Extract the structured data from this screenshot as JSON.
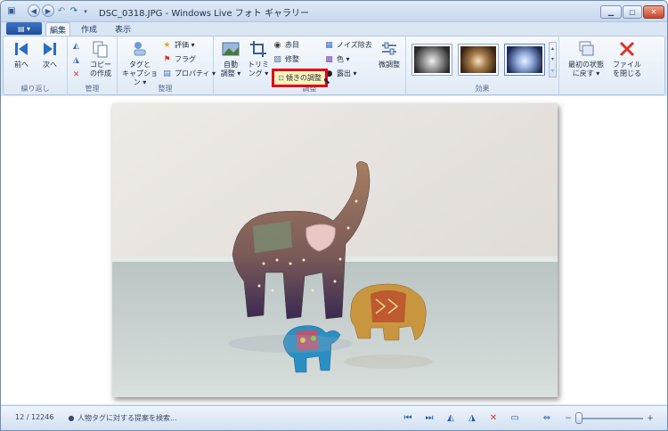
{
  "window": {
    "title": "DSC_0318.JPG - Windows Live フォト ギャラリー"
  },
  "tabs": [
    {
      "label": "編集",
      "active": true
    },
    {
      "label": "作成",
      "active": false
    },
    {
      "label": "表示",
      "active": false
    }
  ],
  "ribbon": {
    "groups": {
      "navigation": {
        "label": "繰り返し",
        "prev": "前へ",
        "next": "次へ"
      },
      "manage": {
        "label": "管理",
        "copy_line1": "コピー",
        "copy_line2": "の作成"
      },
      "organize": {
        "label": "整理",
        "tag_line1": "タグと",
        "tag_line2": "キャプション ▾",
        "rating": "評価 ▾",
        "flag": "フラグ",
        "properties": "プロパティ ▾"
      },
      "adjust": {
        "label": "調整",
        "auto_line1": "自動",
        "auto_line2": "調整 ▾",
        "trim_line1": "トリミ",
        "trim_line2": "ング ▾",
        "redeye": "赤目",
        "retouch": "修整",
        "straighten": "傾きの調整",
        "noise": "ノイズ除去",
        "color": "色 ▾",
        "exposure": "露出 ▾",
        "finetune": "微調整"
      },
      "effects": {
        "label": "効果"
      },
      "revert": {
        "revert_line1": "最初の状態",
        "revert_line2": "に戻す ▾",
        "close_line1": "ファイル",
        "close_line2": "を閉じる"
      }
    }
  },
  "status": {
    "counter": "12 / 12246",
    "people_tag": "人物タグに対する提案を検索..."
  },
  "colors": {
    "accent": "#2a5ea8",
    "highlight_border": "#e0001b",
    "close_red": "#d9352a"
  }
}
